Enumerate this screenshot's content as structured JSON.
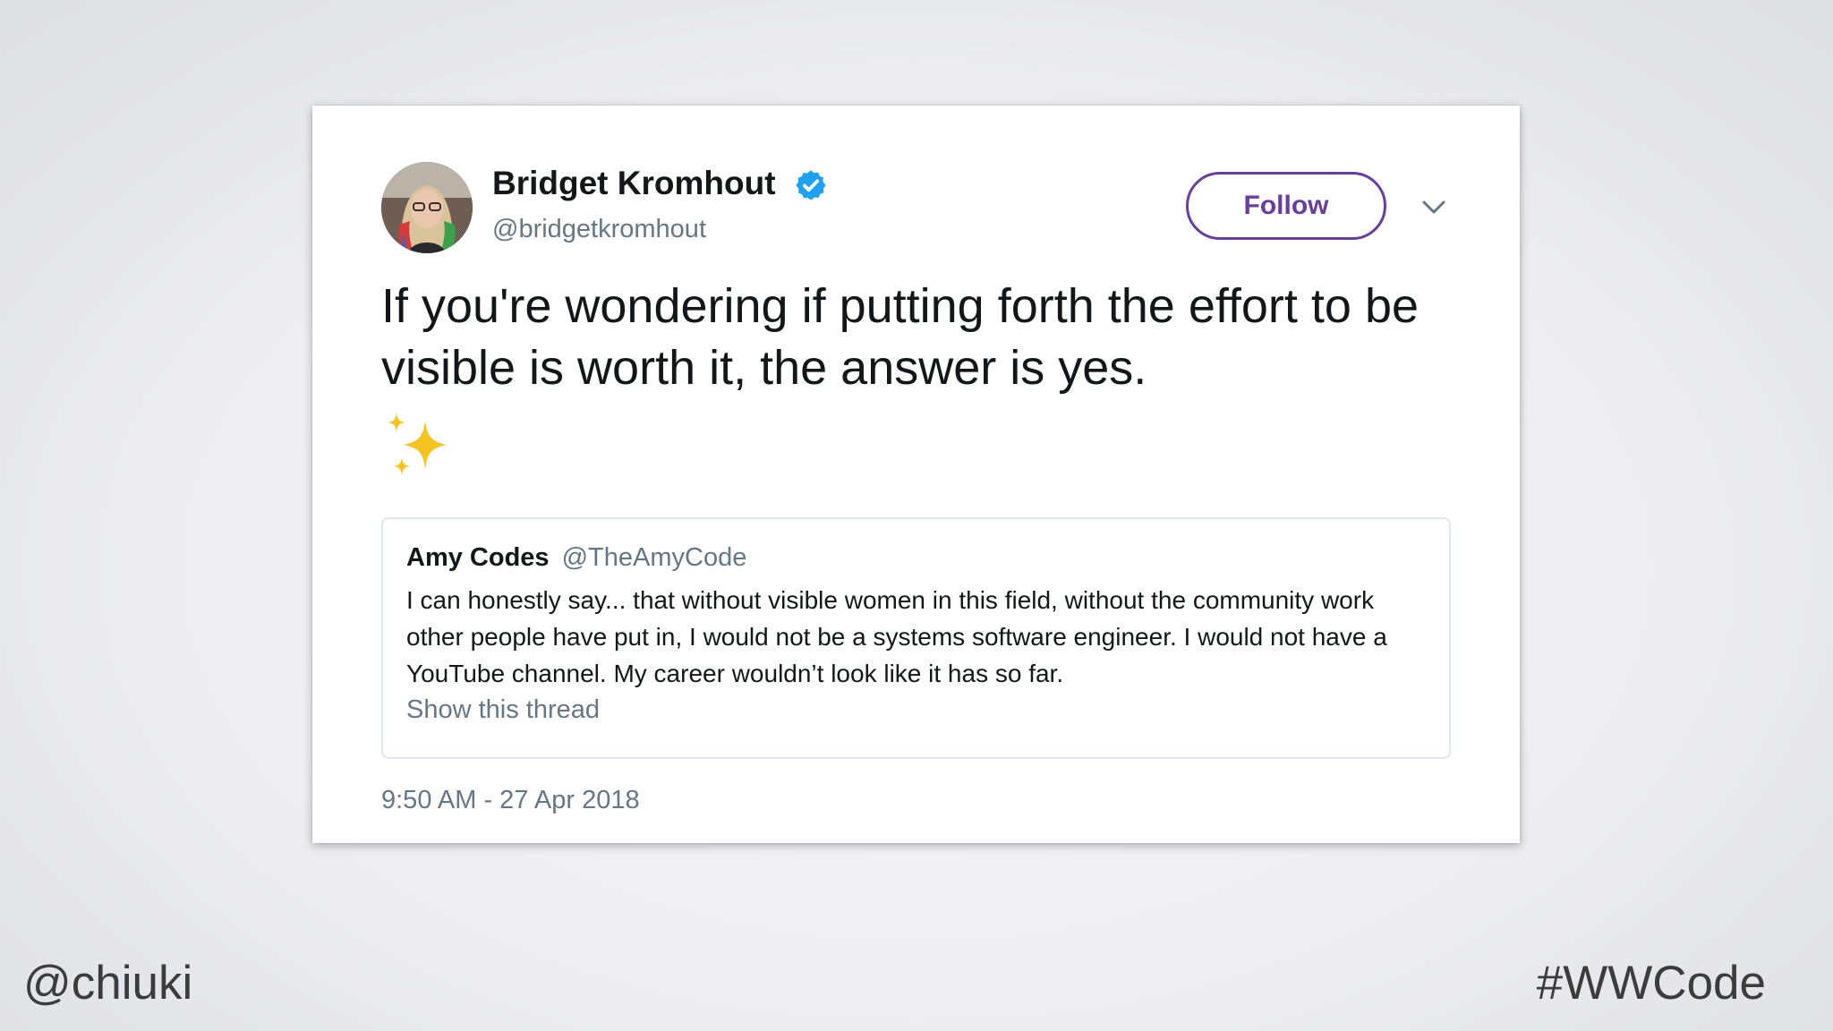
{
  "tweet": {
    "author": {
      "name": "Bridget Kromhout",
      "handle": "@bridgetkromhout",
      "verified": true,
      "avatar_icon": "profile-photo-avatar"
    },
    "follow_label": "Follow",
    "menu_icon": "chevron-down-icon",
    "text": "If you're wondering if putting forth the effort to be visible is worth it, the answer is yes.",
    "emoji": "sparkles-icon",
    "quoted": {
      "name": "Amy Codes",
      "handle": "@TheAmyCode",
      "text": "I can honestly say... that without visible women in this field, without the community work other people have put in, I would not be a systems software engineer. I would not have a YouTube channel. My career wouldn’t look like it has so far.",
      "show_thread_label": "Show this thread"
    },
    "timestamp": "9:50 AM - 27 Apr 2018"
  },
  "slide": {
    "footer_left": "@chiuki",
    "footer_right": "#WWCode"
  },
  "colors": {
    "accent": "#6a3ea1",
    "verified": "#1da1f2",
    "secondary_text": "#657786",
    "border": "#e1e8ed"
  }
}
